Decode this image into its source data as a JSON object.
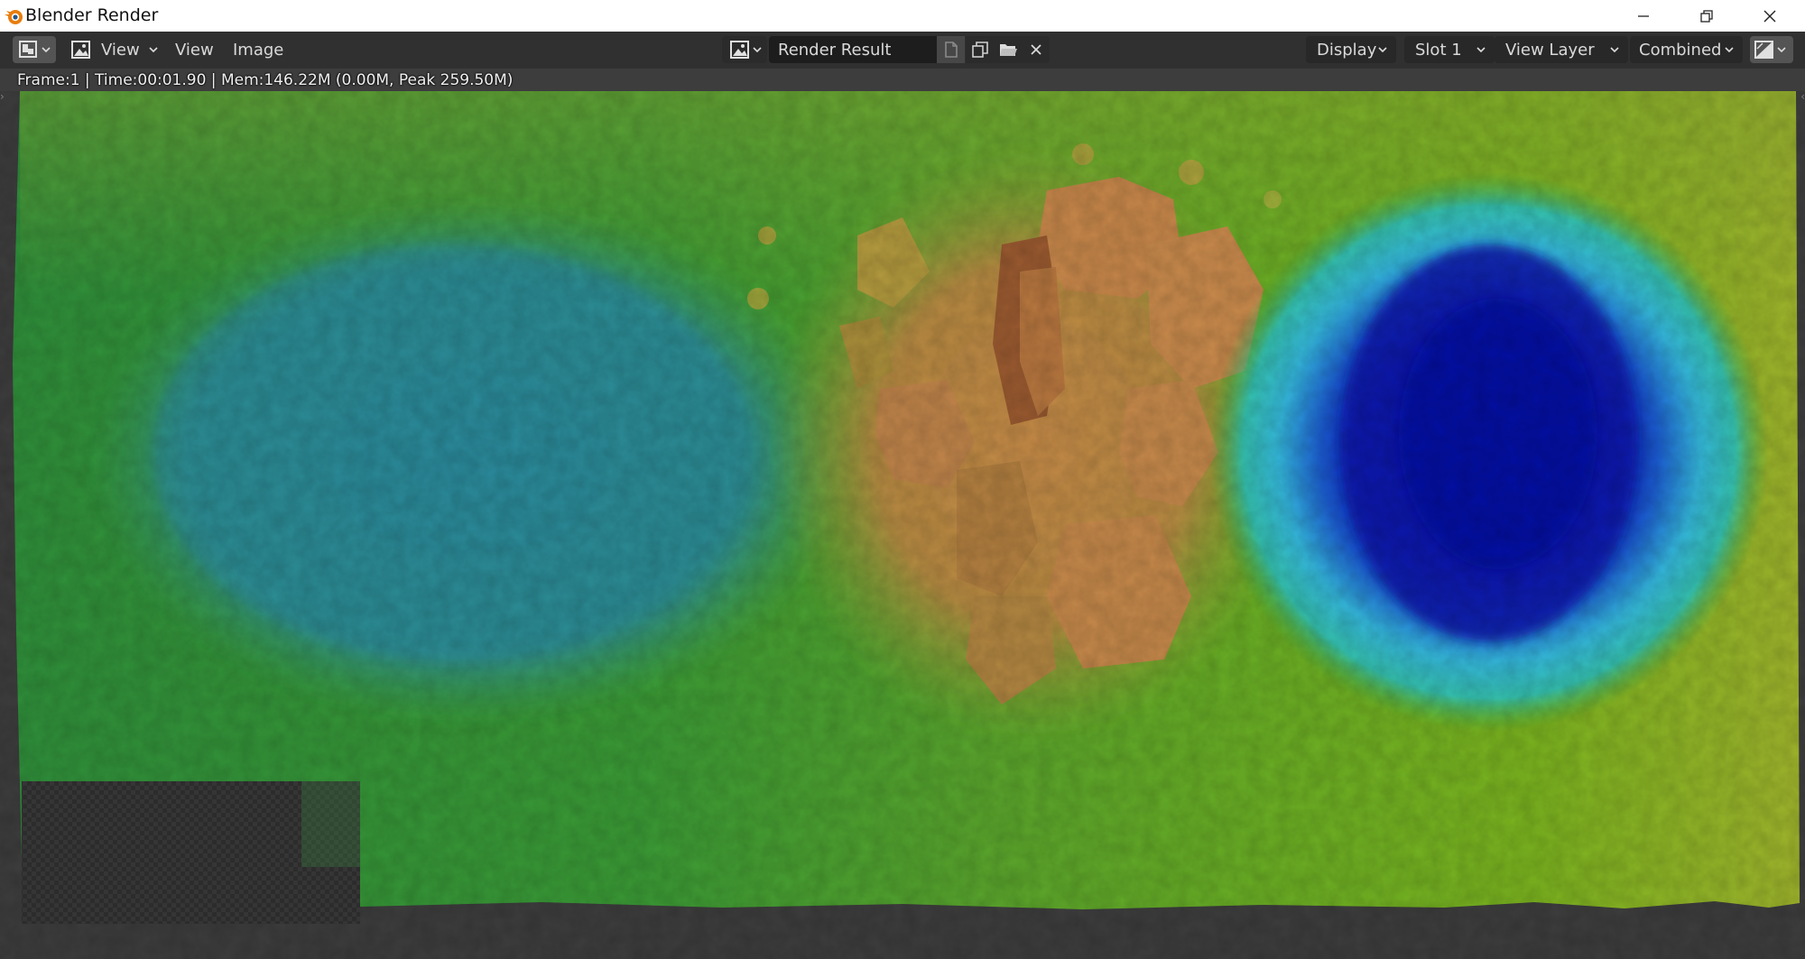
{
  "window": {
    "title": "Blender Render",
    "controls": {
      "minimize": "—",
      "maximize": "❐",
      "close": "✕"
    }
  },
  "header": {
    "editor_type_icon": "image-editor-icon",
    "view_mode_label": "View",
    "menus": {
      "view": "View",
      "image": "Image"
    },
    "image_name": "Render Result",
    "image_buttons": [
      "new-image-icon",
      "duplicate-image-icon",
      "open-folder-icon",
      "close-icon"
    ],
    "display_label": "Display",
    "slot_label": "Slot 1",
    "view_layer_label": "View Layer",
    "pass_label": "Combined",
    "channel_icon": "display-channels-icon"
  },
  "editor": {
    "render_stats": "Frame:1 | Time:00:01.90 | Mem:146.22M (0.00M, Peak 259.50M)",
    "render_content": "color-mapped terrain depth render"
  },
  "colors": {
    "titlebar_bg": "#ffffff",
    "header_bg": "#303030",
    "editor_bg": "#3d3d3d",
    "terrain_green": "#3fa52a",
    "terrain_teal": "#2b8b8f",
    "terrain_orange": "#c48a47",
    "terrain_blue": "#0d1fb8",
    "terrain_cyan": "#3fc9de"
  }
}
